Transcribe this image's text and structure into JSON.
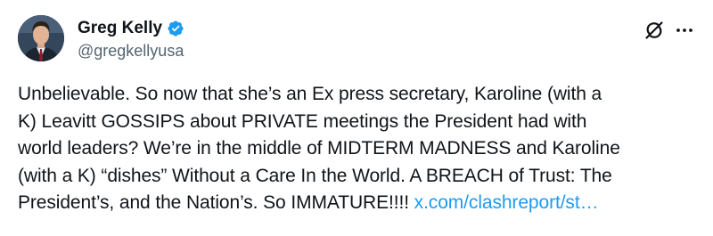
{
  "tweet": {
    "author": {
      "display_name": "Greg Kelly",
      "handle": "@gregkellyusa",
      "verified": true,
      "verified_color": "#1d9bf0"
    },
    "icons": {
      "grok": "grok-icon",
      "more": "more-icon"
    },
    "text": "Unbelievable. So now that she’s an Ex press secretary, Karoline (with a\nK) Leavitt GOSSIPS about PRIVATE meetings the President had with\nworld leaders? We’re in the middle of MIDTERM MADNESS and Karoline\n(with a K) “dishes” Without  a Care In the World.  A BREACH of Trust: The\nPresident’s, and the Nation’s.  So IMMATURE!!!! ",
    "link_text": "x.com/clashreport/st…",
    "colors": {
      "text": "#0f1419",
      "secondary": "#536471",
      "link": "#1d9bf0"
    }
  }
}
